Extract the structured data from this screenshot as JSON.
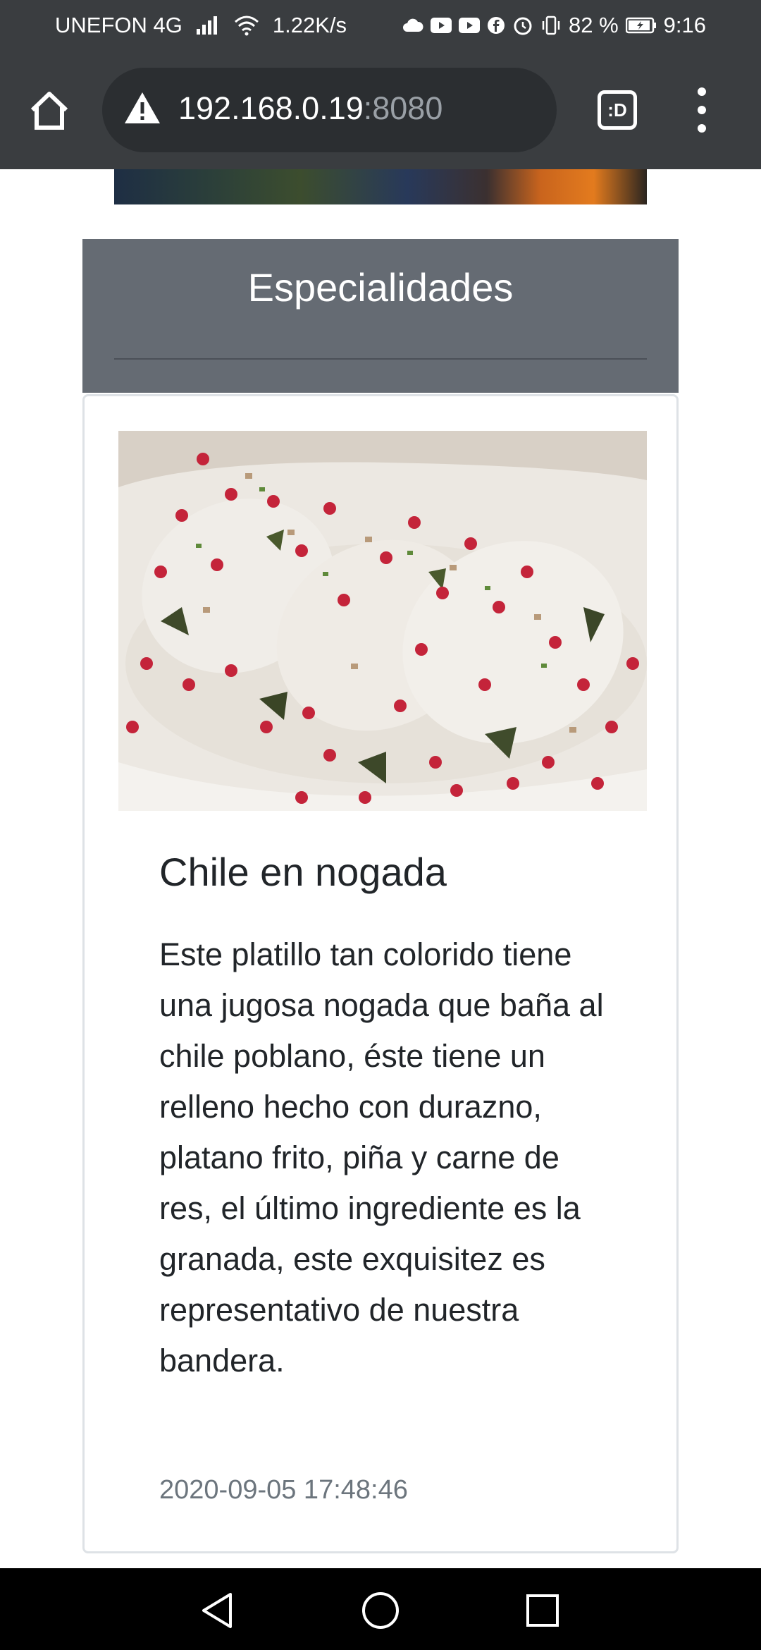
{
  "status_bar": {
    "carrier": "UNEFON 4G",
    "net_speed": "1.22K/s",
    "battery": "82 %",
    "time": "9:16",
    "icons": [
      "signal-icon",
      "wifi-icon",
      "cloud-icon",
      "youtube-icon",
      "youtube-icon",
      "facebook-icon",
      "alarm-icon",
      "vibrate-icon",
      "battery-icon"
    ]
  },
  "browser": {
    "url_host": "192.168.0.19",
    "url_port": ":8080",
    "tabs_label": ":D"
  },
  "section": {
    "title": "Especialidades"
  },
  "card": {
    "title": "Chile en nogada",
    "description": "Este platillo tan colorido tiene una jugosa nogada que baña al chile poblano, éste tiene un relleno hecho con durazno, platano frito, piña y carne de res, el último ingrediente es la granada, este exquisitez es representativo de nuestra bandera.",
    "date": "2020-09-05 17:48:46"
  },
  "colors": {
    "browser_bg": "#3a3d40",
    "section_header_bg": "#656b73",
    "text_dark": "#212529",
    "text_muted": "#6c757d"
  }
}
